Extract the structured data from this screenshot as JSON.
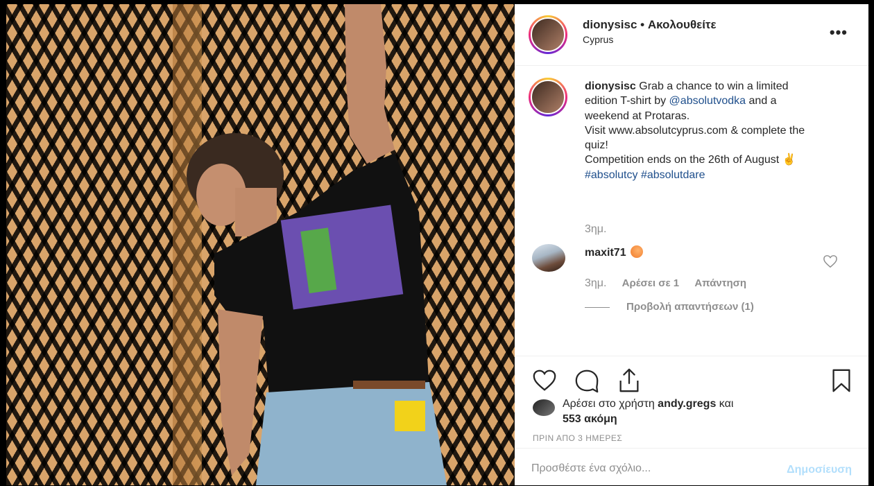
{
  "header": {
    "username": "dionysisc",
    "separator": "•",
    "follow_label": "Ακολουθείτε",
    "location": "Cyprus",
    "more_label": "•••"
  },
  "caption": {
    "username": "dionysisc",
    "text_1": "Grab a chance to win a limited edition T-shirt by",
    "mention": "@absolutvodka",
    "text_2": "and a weekend at Protaras.",
    "text_3": "Visit www.absolutcyprus.com & complete the quiz!",
    "text_4": "Competition ends on the 26th of August ✌",
    "hashtag_1": "#absolutcy",
    "hashtag_2": "#absolutdare",
    "time": "3ημ."
  },
  "comment": {
    "username": "maxit71",
    "time": "3ημ.",
    "likes_label": "Αρέσει σε 1",
    "reply_label": "Απάντηση",
    "view_replies_label": "Προβολή απαντήσεων (1)"
  },
  "likes": {
    "prefix": "Αρέσει στο χρήστη",
    "user": "andy.gregs",
    "and": "και",
    "others": "553 ακόμη"
  },
  "post_age": "ΠΡΙΝ ΑΠΟ 3 ΗΜΕΡΕΣ",
  "add_comment": {
    "placeholder": "Προσθέστε ένα σχόλιο...",
    "post_label": "Δημοσίευση"
  },
  "icons": {
    "like": "heart-icon",
    "comment": "comment-bubble-icon",
    "share": "share-icon",
    "save": "bookmark-icon"
  },
  "colors": {
    "link": "#1f4f8c",
    "muted": "#8e8e8e",
    "post_disabled": "#b2dffc"
  }
}
